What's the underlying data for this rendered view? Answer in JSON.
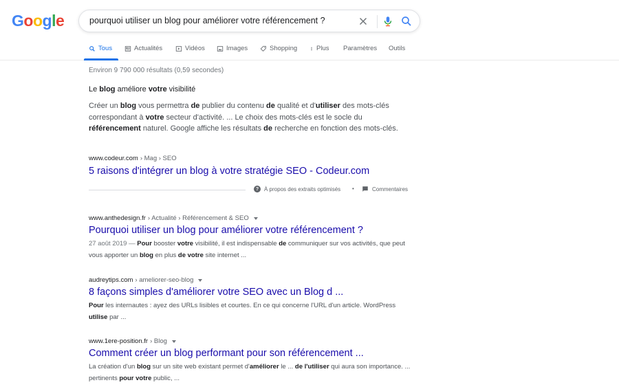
{
  "logo": {
    "g1": "G",
    "o1": "o",
    "o2": "o",
    "g2": "g",
    "l": "l",
    "e": "e"
  },
  "search": {
    "query": "pourquoi utiliser un blog pour améliorer votre référencement ?"
  },
  "tabs": [
    {
      "label": "Tous",
      "icon": "search-icon",
      "active": true
    },
    {
      "label": "Actualités",
      "icon": "news-icon"
    },
    {
      "label": "Vidéos",
      "icon": "video-icon"
    },
    {
      "label": "Images",
      "icon": "image-icon"
    },
    {
      "label": "Shopping",
      "icon": "tag-icon"
    },
    {
      "label": "Plus",
      "icon": "more-vert-icon"
    },
    {
      "label": "Paramètres"
    },
    {
      "label": "Outils"
    }
  ],
  "stats": "Environ 9 790 000 résultats (0,59 secondes)",
  "featured": {
    "title_parts": [
      "Le ",
      "blog",
      " améliore ",
      "votre",
      " visibilité"
    ],
    "text_parts": [
      "Créer un ",
      "blog",
      " vous permettra ",
      "de",
      " publier du contenu ",
      "de",
      " qualité et d'",
      "utiliser",
      " des mots-clés correspondant à ",
      "votre",
      " secteur d'activité. ... Le choix des mots-clés est le socle du ",
      "référencement",
      " naturel. Google affiche les résultats ",
      "de",
      " recherche en fonction des mots-clés."
    ],
    "cite_domain": "www.codeur.com",
    "cite_path": " › Mag › SEO",
    "link": "5 raisons d'intégrer un blog à votre stratégie SEO - Codeur.com",
    "about_label": "À propos des extraits optimisés",
    "separator": "•",
    "comments_label": "Commentaires"
  },
  "results": [
    {
      "cite_domain": "www.anthedesign.fr",
      "cite_path": " › Actualité › Référencement & SEO",
      "title": "Pourquoi utiliser un blog pour améliorer votre référencement ?",
      "date": "27 août 2019 — ",
      "desc_parts": [
        "Pour",
        " booster ",
        "votre",
        " visibilité, il est indispensable ",
        "de",
        " communiquer sur vos activités, que peut vous apporter un ",
        "blog",
        " en plus ",
        "de votre",
        " site internet ..."
      ]
    },
    {
      "cite_domain": "audreytips.com",
      "cite_path": " › ameliorer-seo-blog",
      "title": "8 façons simples d'améliorer votre SEO avec un Blog d ...",
      "date": "",
      "desc_parts": [
        "Pour",
        " les internautes : ayez des URLs lisibles et courtes. En ce qui concerne l'URL d'un article. WordPress ",
        "utilise",
        " par ..."
      ]
    },
    {
      "cite_domain": "www.1ere-position.fr",
      "cite_path": " › Blog",
      "title": "Comment créer un blog performant pour son référencement ...",
      "date": "",
      "desc_parts": [
        "La création d'un ",
        "blog",
        " sur un site web existant permet d'",
        "améliorer",
        " le ... ",
        "de l'utiliser",
        " qui aura son importance. ... pertinents ",
        "pour votre",
        " public, ..."
      ]
    }
  ]
}
